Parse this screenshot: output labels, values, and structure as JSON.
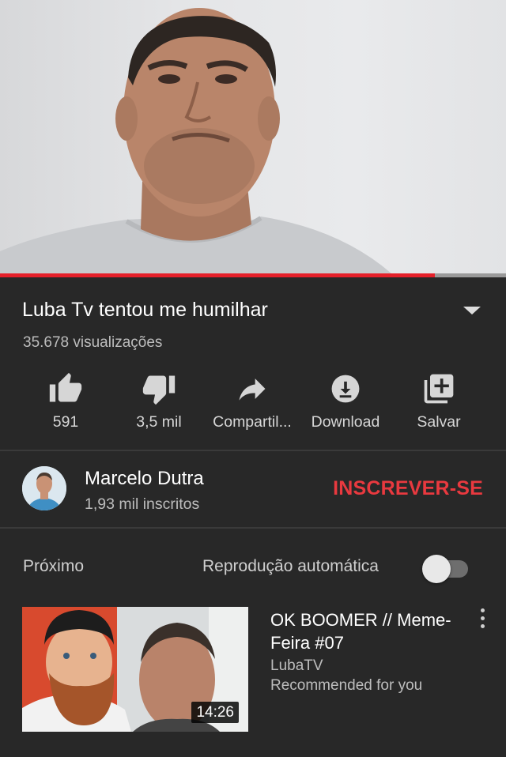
{
  "player": {
    "progress_fraction": 0.86,
    "progress_color": "#e5202a"
  },
  "video": {
    "title": "Luba Tv tentou me humilhar",
    "views": "35.678 visualizações"
  },
  "actions": [
    {
      "icon": "thumbs-up-icon",
      "label": "591"
    },
    {
      "icon": "thumbs-down-icon",
      "label": "3,5 mil"
    },
    {
      "icon": "share-icon",
      "label": "Compartil..."
    },
    {
      "icon": "download-icon",
      "label": "Download"
    },
    {
      "icon": "add-to-playlist-icon",
      "label": "Salvar"
    }
  ],
  "channel": {
    "name": "Marcelo Dutra",
    "subscribers": "1,93 mil inscritos",
    "subscribe_label": "INSCREVER-SE",
    "subscribe_color": "#e9393f"
  },
  "up_next": {
    "label": "Próximo",
    "autoplay_label": "Reprodução automática",
    "autoplay_on": false
  },
  "recommended": [
    {
      "title": "OK BOOMER // Meme-Feira #07",
      "channel": "LubaTV",
      "meta": "Recommended for you",
      "duration": "14:26"
    }
  ]
}
